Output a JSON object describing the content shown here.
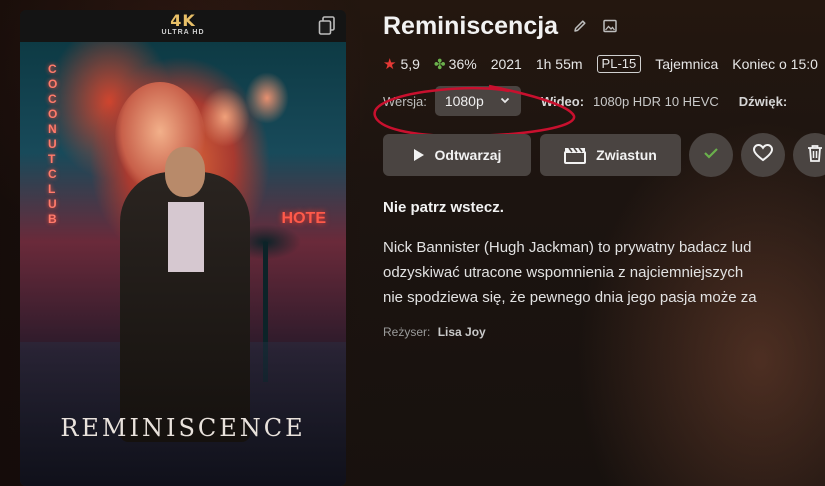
{
  "poster": {
    "badge_main": "4K",
    "badge_sub": "ULTRA HD",
    "title_text": "REMINISCENCE",
    "neon_text": "COCONUT CLUB",
    "hotel_text": "HOTE"
  },
  "movie": {
    "title": "Reminiscencja",
    "rating": "5,9",
    "audience_score": "36%",
    "year": "2021",
    "runtime": "1h 55m",
    "age_rating": "PL-15",
    "genre": "Tajemnica",
    "end_time": "Koniec o 15:0"
  },
  "version": {
    "label": "Wersja:",
    "selected": "1080p",
    "video_label": "Wideo:",
    "video_value": "1080p HDR 10 HEVC",
    "audio_label": "Dźwięk:"
  },
  "actions": {
    "play_label": "Odtwarzaj",
    "trailer_label": "Zwiastun"
  },
  "tagline": "Nie patrz wstecz.",
  "overview": [
    "Nick Bannister (Hugh Jackman) to prywatny badacz lud",
    "odzyskiwać utracone wspomnienia z najciemniejszych",
    "nie spodziewa się, że pewnego dnia jego pasja może za"
  ],
  "director": {
    "label": "Reżyser:",
    "name": "Lisa Joy"
  },
  "colors": {
    "star": "#e53935",
    "clover": "#6ab04c",
    "check": "#6ab04c",
    "annotation": "#c8102e",
    "badge_gold": "#e8c068",
    "button_bg": "#4a4441"
  }
}
